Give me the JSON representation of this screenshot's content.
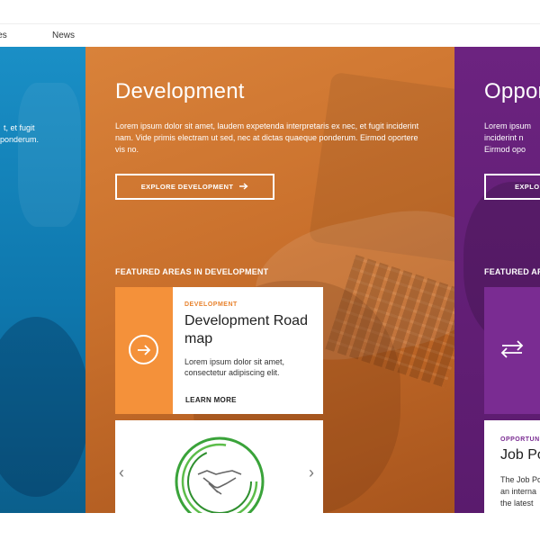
{
  "nav": {
    "partial_item": "ities",
    "news": "News"
  },
  "blue_panel": {
    "lines": [
      "t, et fugit",
      "ponderum."
    ]
  },
  "orange_panel": {
    "title": "Development",
    "description": "Lorem ipsum dolor sit amet, laudem expetenda interpretaris ex nec, et fugit inciderint nam. Vide primis electram ut sed, nec at dictas quaeque ponderum. Eirmod oportere vis no.",
    "explore_button": "EXPLORE DEVELOPMENT",
    "featured_label": "FEATURED AREAS IN DEVELOPMENT",
    "card": {
      "eyebrow": "DEVELOPMENT",
      "title": "Development Road map",
      "body": "Lorem ipsum dolor sit amet, consectetur adipiscing elit.",
      "link": "LEARN MORE"
    },
    "carousel": {
      "prev": "‹",
      "next": "›"
    }
  },
  "purple_panel": {
    "title": "Oppor",
    "lines": [
      "Lorem ipsum",
      "inciderint n",
      "Eirmod opo"
    ],
    "button": "EXPLO",
    "featured_label": "FEATURED AR",
    "card": {
      "eyebrow": "OPPORTUN",
      "title": "Job Po",
      "body_lines": [
        "The Job Po",
        "an interna",
        "the latest"
      ]
    }
  },
  "colors": {
    "blue": "#0e77ad",
    "orange": "#c9702c",
    "orange_accent": "#f4913a",
    "purple": "#5a1b6d",
    "purple_accent": "#7a2c92",
    "green": "#3aa33a"
  },
  "icons": {
    "arrow_right": "arrow-right-icon",
    "circle_arrow": "circle-arrow-icon",
    "swap": "swap-arrows-icon",
    "handshake": "handshake-icon"
  }
}
